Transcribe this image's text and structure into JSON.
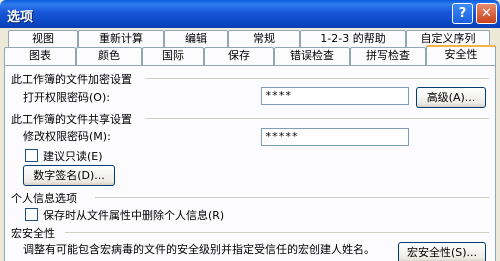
{
  "window": {
    "title": "选项",
    "help_icon": "?",
    "close_icon": "✕"
  },
  "tabs_row1": [
    "视图",
    "重新计算",
    "编辑",
    "常规",
    "1-2-3 的帮助",
    "自定义序列"
  ],
  "tabs_row2": [
    "图表",
    "颜色",
    "国际",
    "保存",
    "错误检查",
    "拼写检查",
    "安全性"
  ],
  "encrypt": {
    "title": "此工作簿的文件加密设置",
    "open_password_label": "打开权限密码(O):",
    "open_password_value": "****",
    "advanced_button": "高级(A)..."
  },
  "share": {
    "title": "此工作簿的文件共享设置",
    "modify_password_label": "修改权限密码(M):",
    "modify_password_value": "*****",
    "readonly_label": "建议只读(E)",
    "digital_signature_button": "数字签名(D)..."
  },
  "privacy": {
    "title": "个人信息选项",
    "remove_personal_label": "保存时从文件属性中删除个人信息(R)"
  },
  "macro": {
    "title": "宏安全性",
    "description": "调整有可能包含宏病毒的文件的安全级别并指定受信任的宏创建人姓名。",
    "macro_security_button": "宏安全性(S)..."
  }
}
